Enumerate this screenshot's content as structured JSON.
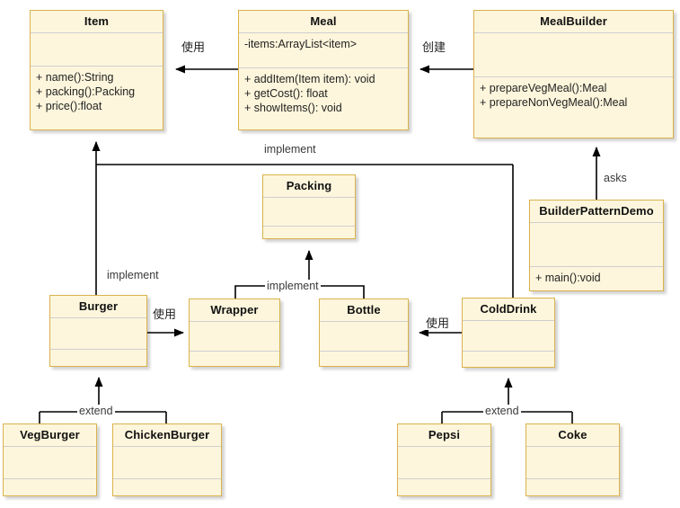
{
  "diagram": {
    "title": "Builder Pattern UML Class Diagram",
    "colors": {
      "box_fill": "#fdf6dc",
      "box_border": "#d9b24c",
      "separator": "#cfcfcf",
      "line": "#000000",
      "label_text": "#3a3a3a",
      "background": "#ffffff"
    }
  },
  "classes": {
    "item": {
      "name": "Item",
      "attributes": [],
      "methods": [
        "+ name():String",
        "+ packing():Packing",
        "+ price():float"
      ]
    },
    "meal": {
      "name": "Meal",
      "attributes": [
        "-items:ArrayList<item>"
      ],
      "methods": [
        "+ addItem(Item item): void",
        "+ getCost(): float",
        "+ showItems(): void"
      ]
    },
    "meal_builder": {
      "name": "MealBuilder",
      "attributes": [],
      "methods": [
        "+ prepareVegMeal():Meal",
        "+ prepareNonVegMeal():Meal"
      ]
    },
    "packing": {
      "name": "Packing",
      "attributes": [],
      "methods": []
    },
    "builder_pattern_demo": {
      "name": "BuilderPatternDemo",
      "attributes": [],
      "methods": [
        "+ main():void"
      ]
    },
    "burger": {
      "name": "Burger",
      "attributes": [],
      "methods": []
    },
    "wrapper": {
      "name": "Wrapper",
      "attributes": [],
      "methods": []
    },
    "bottle": {
      "name": "Bottle",
      "attributes": [],
      "methods": []
    },
    "cold_drink": {
      "name": "ColdDrink",
      "attributes": [],
      "methods": []
    },
    "veg_burger": {
      "name": "VegBurger",
      "attributes": [],
      "methods": []
    },
    "chicken_burger": {
      "name": "ChickenBurger",
      "attributes": [],
      "methods": []
    },
    "pepsi": {
      "name": "Pepsi",
      "attributes": [],
      "methods": []
    },
    "coke": {
      "name": "Coke",
      "attributes": [],
      "methods": []
    }
  },
  "edges": {
    "meal_uses_item": "使用",
    "mealbuilder_creates_meal": "创建",
    "item_implement": "implement",
    "packing_implement": "implement",
    "burger_implement": "implement",
    "burger_uses_wrapper": "使用",
    "colddrink_uses_bottle": "使用",
    "burger_extend": "extend",
    "colddrink_extend": "extend",
    "demo_asks_builder": "asks"
  }
}
